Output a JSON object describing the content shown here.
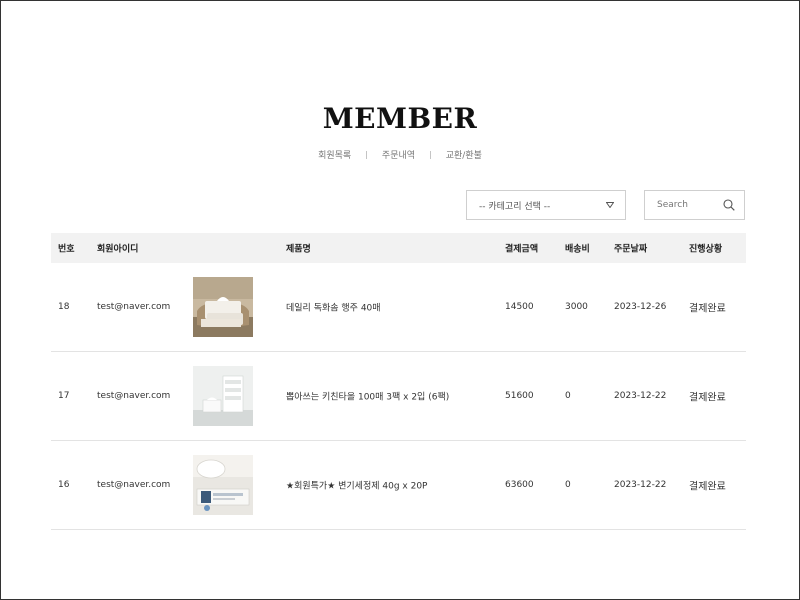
{
  "page": {
    "title": "MEMBER",
    "subnav": [
      "회원목록",
      "주문내역",
      "교환/환불"
    ]
  },
  "filter": {
    "category_selected": "-- 카테고리 선택 --",
    "search_placeholder": "Search"
  },
  "table": {
    "headers": {
      "no": "번호",
      "member_id": "회원아이디",
      "product": "제품명",
      "amount": "결제금액",
      "shipping": "배송비",
      "order_date": "주문날짜",
      "status": "진행상황"
    },
    "rows": [
      {
        "no": "18",
        "member_id": "test@naver.com",
        "product": "데일리 독화솜 행주 40매",
        "amount": "14500",
        "shipping": "3000",
        "order_date": "2023-12-26",
        "status": "결제완료"
      },
      {
        "no": "17",
        "member_id": "test@naver.com",
        "product": "뽑아쓰는 키친타올 100매 3팩 x 2입 (6팩)",
        "amount": "51600",
        "shipping": "0",
        "order_date": "2023-12-22",
        "status": "결제완료"
      },
      {
        "no": "16",
        "member_id": "test@naver.com",
        "product": "★회원특가★ 변기세정제 40g x 20P",
        "amount": "63600",
        "shipping": "0",
        "order_date": "2023-12-22",
        "status": "결제완료"
      }
    ]
  },
  "colors": {
    "header_bg": "#f2f2f2",
    "border": "#cfcfcf",
    "row_divider": "#e3e3e3"
  }
}
